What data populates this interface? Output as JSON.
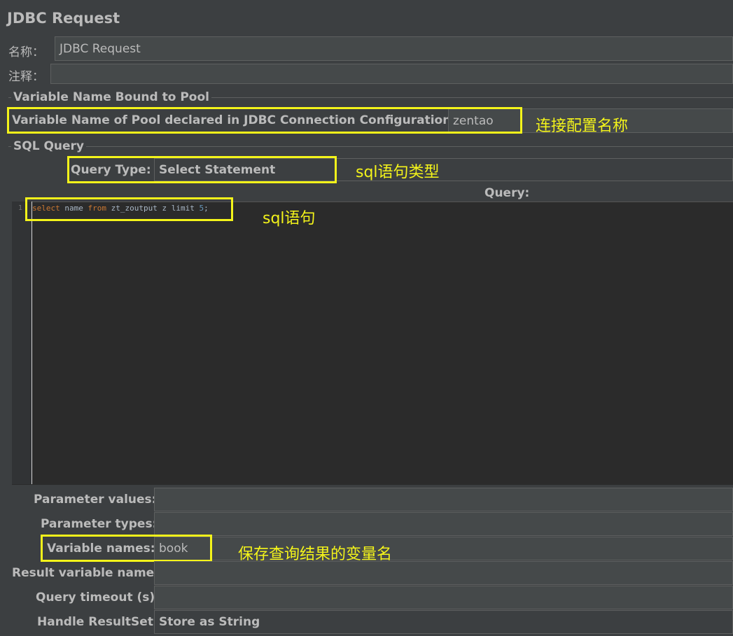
{
  "header": {
    "title": "JDBC Request"
  },
  "name_row": {
    "label": "名称：",
    "value": "JDBC Request"
  },
  "comment_row": {
    "label": "注释：",
    "value": ""
  },
  "pool_group": {
    "title": "Variable Name Bound to Pool",
    "label": "Variable Name of Pool declared in JDBC Connection Configuration:",
    "value": "zentao"
  },
  "sql_group": {
    "title": "SQL Query",
    "query_type_label": "Query Type:",
    "query_type_value": "Select Statement",
    "query_label": "Query:"
  },
  "editor": {
    "line_number": "1",
    "tokens": {
      "t1": "select",
      "t2": " name ",
      "t3": "from",
      "t4": " zt_zoutput z limit ",
      "t5": "5",
      "t6": ";"
    }
  },
  "params": {
    "parameter_values_label": "Parameter values:",
    "parameter_values_value": "",
    "parameter_types_label": "Parameter types:",
    "parameter_types_value": "",
    "variable_names_label": "Variable names:",
    "variable_names_value": "book",
    "result_variable_label": "Result variable name:",
    "result_variable_value": "",
    "query_timeout_label": "Query timeout (s):",
    "query_timeout_value": "",
    "handle_resultset_label": "Handle ResultSet:",
    "handle_resultset_value": "Store as String"
  },
  "annotations": {
    "pool": "连接配置名称",
    "query_type": "sql语句类型",
    "sql": "sql语句",
    "variable_names": "保存查询结果的变量名"
  },
  "colors": {
    "background": "#3c3f41",
    "field": "#45494a",
    "editor": "#2b2b2b",
    "annotation": "#f4f41a",
    "keyword": "#cc7832",
    "number": "#6897bb"
  }
}
